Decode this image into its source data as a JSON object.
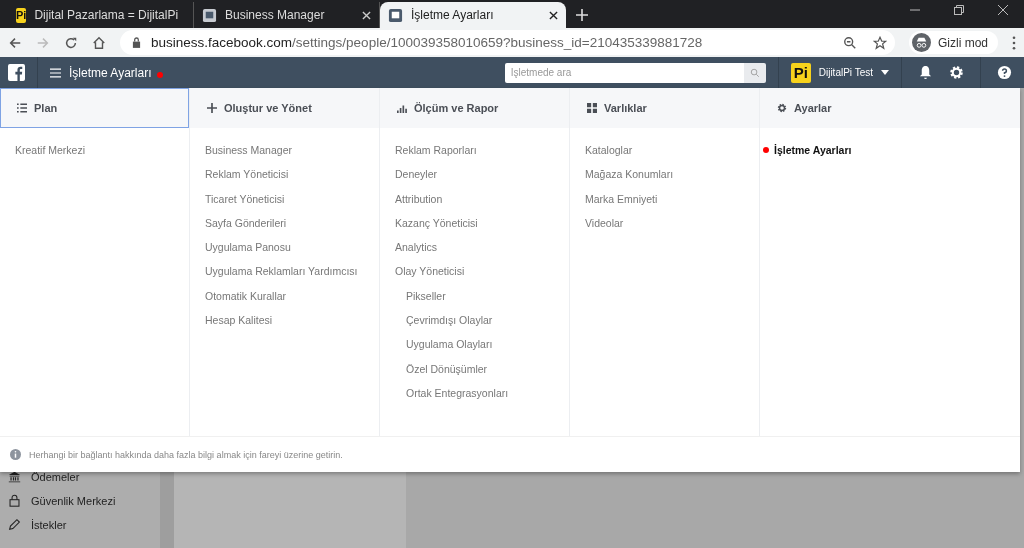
{
  "browser": {
    "tabs": [
      {
        "title": "Dijital Pazarlama = DijitalPi",
        "kind": "logo",
        "logo_text": "Pi",
        "selected": false
      },
      {
        "title": "Business Manager",
        "kind": "page",
        "selected": false
      },
      {
        "title": "İşletme Ayarları",
        "kind": "page",
        "selected": true
      }
    ],
    "url_host": "business.facebook.com",
    "url_path": "/settings/people/100039358010659?business_id=210435339881728",
    "profile": "Gizli mod"
  },
  "top_bar": {
    "title": "İşletme Ayarları",
    "alert": true,
    "search": {
      "placeholder": "İşletmede ara"
    },
    "account": {
      "logo_text": "Pi",
      "name": "DijitalPi Test"
    }
  },
  "menu": {
    "columns": [
      {
        "title": "Plan",
        "kind": "list",
        "selected": true,
        "items": [
          {
            "label": "Kreatif Merkezi",
            "selected": false
          }
        ]
      },
      {
        "title": "Oluştur ve Yönet",
        "kind": "plus",
        "selected": false,
        "items": [
          {
            "label": "Business Manager",
            "selected": false
          },
          {
            "label": "Reklam Yöneticisi",
            "selected": false
          },
          {
            "label": "Ticaret Yöneticisi",
            "selected": false
          },
          {
            "label": "Sayfa Gönderileri",
            "selected": false
          },
          {
            "label": "Uygulama Panosu",
            "selected": false
          },
          {
            "label": "Uygulama Reklamları Yardımcısı",
            "selected": false
          },
          {
            "label": "Otomatik Kurallar",
            "selected": false
          },
          {
            "label": "Hesap Kalitesi",
            "selected": false
          }
        ]
      },
      {
        "title": "Ölçüm ve Rapor",
        "kind": "bars",
        "selected": false,
        "items": [
          {
            "label": "Reklam Raporları",
            "selected": false
          },
          {
            "label": "Deneyler",
            "selected": false
          },
          {
            "label": "Attribution",
            "selected": false
          },
          {
            "label": "Kazanç Yöneticisi",
            "selected": false
          },
          {
            "label": "Analytics",
            "selected": false
          },
          {
            "label": "Olay Yöneticisi",
            "selected": false,
            "children": [
              {
                "label": "Pikseller",
                "selected": false
              },
              {
                "label": "Çevrimdışı Olaylar",
                "selected": false
              },
              {
                "label": "Uygulama Olayları",
                "selected": false
              },
              {
                "label": "Özel Dönüşümler",
                "selected": false
              },
              {
                "label": "Ortak Entegrasyonları",
                "selected": false
              }
            ]
          }
        ]
      },
      {
        "title": "Varlıklar",
        "kind": "grid",
        "selected": false,
        "items": [
          {
            "label": "Kataloglar",
            "selected": false
          },
          {
            "label": "Mağaza Konumları",
            "selected": false
          },
          {
            "label": "Marka Emniyeti",
            "selected": false
          },
          {
            "label": "Videolar",
            "selected": false
          }
        ]
      },
      {
        "title": "Ayarlar",
        "kind": "gear",
        "selected": false,
        "items": [
          {
            "label": "İşletme Ayarları",
            "selected": true
          }
        ]
      }
    ],
    "footer": "Herhangi bir bağlantı hakkında daha fazla bilgi almak için fareyi üzerine getirin."
  },
  "sidebar": {
    "items": [
      {
        "label": "Ödemeler",
        "kind": "bank"
      },
      {
        "label": "Güvenlik Merkezi",
        "kind": "lock"
      },
      {
        "label": "İstekler",
        "kind": "pen"
      }
    ]
  }
}
